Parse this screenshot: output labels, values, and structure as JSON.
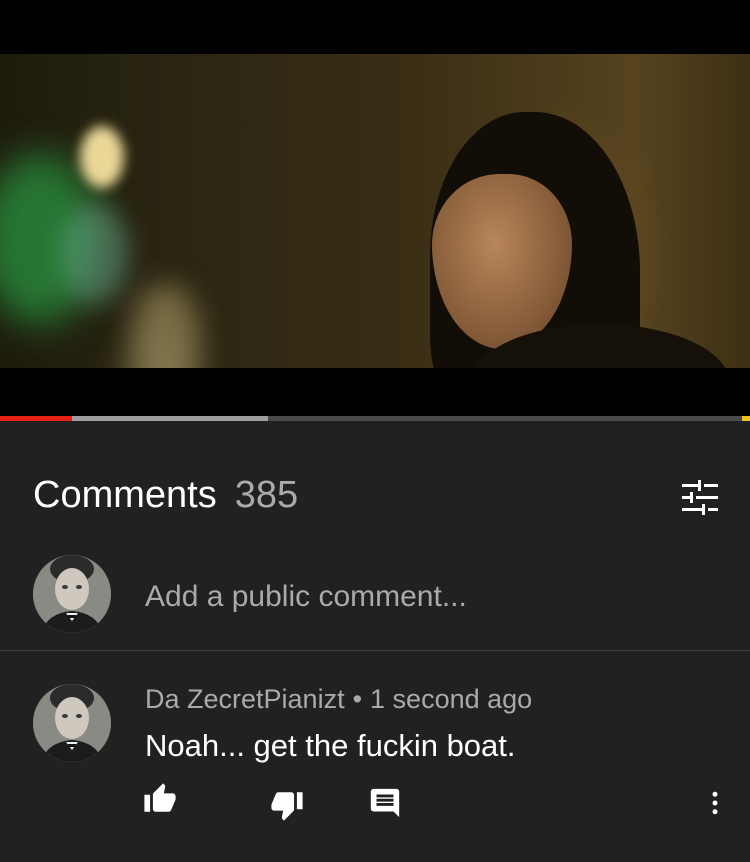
{
  "player": {
    "played_fraction": 0.096,
    "buffered_fraction": 0.357,
    "colors": {
      "played": "#e62117",
      "buffered": "#9e9e9e",
      "track": "#4a4a4a"
    }
  },
  "comments_section": {
    "title": "Comments",
    "count": "385",
    "sort_icon": "sort-filter-icon",
    "add_comment_placeholder": "Add a public comment...",
    "items": [
      {
        "author": "Da ZecretPianizt",
        "separator": "•",
        "time": "1 second ago",
        "text": "Noah... get the fuckin boat.",
        "actions": [
          "thumb-up-icon",
          "thumb-down-icon",
          "reply-icon",
          "more-vert-icon"
        ]
      }
    ]
  },
  "theme": {
    "background": "#212121",
    "text_primary": "#ffffff",
    "text_secondary": "#aaaaaa"
  }
}
